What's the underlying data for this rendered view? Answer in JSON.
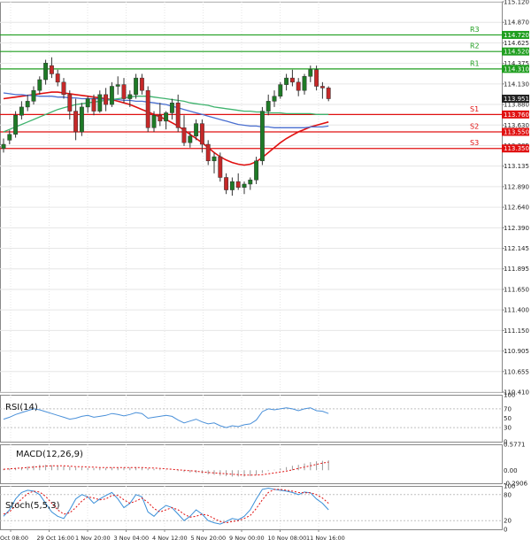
{
  "chart_data": {
    "type": "candlestick",
    "main": {
      "ylim": [
        110.41,
        115.12
      ],
      "y_ticks": [
        "115.120",
        "114.870",
        "114.625",
        "114.375",
        "114.130",
        "113.880",
        "113.630",
        "113.385",
        "113.135",
        "112.890",
        "112.640",
        "112.390",
        "112.145",
        "111.895",
        "111.650",
        "111.400",
        "111.150",
        "110.905",
        "110.655",
        "110.410"
      ],
      "levels": [
        {
          "name": "R3",
          "value": 114.72,
          "label": "114.720",
          "color": "#1f9e1f"
        },
        {
          "name": "R2",
          "value": 114.52,
          "label": "114.520",
          "color": "#1f9e1f"
        },
        {
          "name": "R1",
          "value": 114.31,
          "label": "114.310",
          "color": "#1f9e1f"
        },
        {
          "name": "S1",
          "value": 113.76,
          "label": "113.760",
          "color": "#e01010"
        },
        {
          "name": "S2",
          "value": 113.55,
          "label": "113.550",
          "color": "#e01010"
        },
        {
          "name": "S3",
          "value": 113.35,
          "label": "113.350",
          "color": "#e01010"
        }
      ],
      "current_price": "113.951",
      "candles": [
        [
          113.35,
          113.47,
          113.3,
          113.4
        ],
        [
          113.45,
          113.57,
          113.4,
          113.52
        ],
        [
          113.52,
          113.8,
          113.48,
          113.75
        ],
        [
          113.75,
          113.92,
          113.7,
          113.85
        ],
        [
          113.85,
          114.0,
          113.8,
          113.92
        ],
        [
          113.92,
          114.1,
          113.88,
          114.05
        ],
        [
          114.05,
          114.22,
          114.0,
          114.18
        ],
        [
          114.18,
          114.42,
          114.12,
          114.38
        ],
        [
          114.35,
          114.45,
          114.2,
          114.25
        ],
        [
          114.25,
          114.3,
          114.1,
          114.15
        ],
        [
          114.15,
          114.2,
          113.95,
          114.0
        ],
        [
          114.0,
          114.05,
          113.7,
          113.8
        ],
        [
          113.8,
          113.95,
          113.45,
          113.55
        ],
        [
          113.55,
          113.9,
          113.5,
          113.85
        ],
        [
          113.85,
          113.98,
          113.78,
          113.95
        ],
        [
          113.95,
          114.0,
          113.75,
          113.8
        ],
        [
          113.8,
          114.05,
          113.78,
          114.0
        ],
        [
          114.0,
          114.08,
          113.8,
          113.88
        ],
        [
          113.88,
          114.15,
          113.85,
          114.1
        ],
        [
          114.1,
          114.22,
          114.0,
          114.12
        ],
        [
          114.12,
          114.2,
          113.9,
          113.95
        ],
        [
          113.95,
          114.05,
          113.85,
          114.0
        ],
        [
          114.0,
          114.25,
          113.95,
          114.2
        ],
        [
          114.2,
          114.25,
          114.0,
          114.05
        ],
        [
          114.05,
          114.1,
          113.55,
          113.6
        ],
        [
          113.6,
          113.8,
          113.55,
          113.75
        ],
        [
          113.75,
          113.9,
          113.62,
          113.68
        ],
        [
          113.68,
          113.8,
          113.58,
          113.78
        ],
        [
          113.78,
          113.95,
          113.7,
          113.9
        ],
        [
          113.9,
          114.0,
          113.55,
          113.6
        ],
        [
          113.6,
          113.75,
          113.38,
          113.42
        ],
        [
          113.42,
          113.55,
          113.36,
          113.5
        ],
        [
          113.5,
          113.7,
          113.45,
          113.65
        ],
        [
          113.65,
          113.7,
          113.3,
          113.4
        ],
        [
          113.4,
          113.45,
          113.15,
          113.2
        ],
        [
          113.2,
          113.3,
          113.05,
          113.25
        ],
        [
          113.25,
          113.3,
          112.95,
          113.0
        ],
        [
          113.0,
          113.05,
          112.8,
          112.85
        ],
        [
          112.85,
          113.0,
          112.78,
          112.95
        ],
        [
          112.95,
          113.05,
          112.85,
          112.88
        ],
        [
          112.88,
          112.95,
          112.8,
          112.92
        ],
        [
          112.92,
          113.0,
          112.85,
          112.97
        ],
        [
          112.97,
          113.25,
          112.92,
          113.2
        ],
        [
          113.2,
          113.85,
          113.15,
          113.8
        ],
        [
          113.8,
          114.0,
          113.75,
          113.92
        ],
        [
          113.92,
          114.05,
          113.85,
          113.98
        ],
        [
          113.98,
          114.15,
          113.95,
          114.12
        ],
        [
          114.12,
          114.25,
          114.05,
          114.2
        ],
        [
          114.2,
          114.3,
          114.1,
          114.15
        ],
        [
          114.15,
          114.2,
          113.98,
          114.05
        ],
        [
          114.05,
          114.25,
          114.0,
          114.22
        ],
        [
          114.22,
          114.35,
          114.15,
          114.3
        ],
        [
          114.3,
          114.35,
          114.05,
          114.1
        ],
        [
          114.1,
          114.15,
          113.95,
          114.08
        ],
        [
          114.08,
          114.1,
          113.92,
          113.95
        ]
      ],
      "moving_averages": [
        {
          "color": "#e01010",
          "values": [
            113.95,
            113.96,
            113.97,
            113.98,
            113.99,
            114.0,
            114.01,
            114.02,
            114.03,
            114.03,
            114.02,
            114.01,
            114.0,
            113.99,
            113.98,
            113.97,
            113.96,
            113.95,
            113.94,
            113.92,
            113.9,
            113.88,
            113.85,
            113.82,
            113.79,
            113.76,
            113.73,
            113.7,
            113.66,
            113.62,
            113.57,
            113.52,
            113.47,
            113.42,
            113.36,
            113.3,
            113.25,
            113.21,
            113.18,
            113.16,
            113.15,
            113.16,
            113.19,
            113.24,
            113.3,
            113.36,
            113.42,
            113.47,
            113.51,
            113.55,
            113.58,
            113.61,
            113.63,
            113.65,
            113.67
          ]
        },
        {
          "color": "#4a6fd0",
          "values": [
            114.02,
            114.01,
            114.0,
            114.0,
            113.99,
            113.99,
            113.98,
            113.98,
            113.98,
            113.97,
            113.97,
            113.96,
            113.96,
            113.95,
            113.95,
            113.95,
            113.95,
            113.94,
            113.94,
            113.94,
            113.93,
            113.93,
            113.92,
            113.92,
            113.91,
            113.9,
            113.89,
            113.88,
            113.86,
            113.84,
            113.82,
            113.8,
            113.78,
            113.76,
            113.74,
            113.72,
            113.7,
            113.68,
            113.66,
            113.64,
            113.63,
            113.62,
            113.62,
            113.61,
            113.61,
            113.6,
            113.6,
            113.6,
            113.6,
            113.6,
            113.6,
            113.61,
            113.61,
            113.61,
            113.62
          ]
        },
        {
          "color": "#3fb36e",
          "values": [
            113.55,
            113.58,
            113.61,
            113.64,
            113.67,
            113.7,
            113.73,
            113.76,
            113.79,
            113.82,
            113.84,
            113.86,
            113.88,
            113.89,
            113.9,
            113.91,
            113.92,
            113.93,
            113.94,
            113.95,
            113.96,
            113.97,
            113.98,
            113.98,
            113.98,
            113.97,
            113.96,
            113.95,
            113.94,
            113.93,
            113.92,
            113.9,
            113.89,
            113.88,
            113.87,
            113.85,
            113.84,
            113.83,
            113.82,
            113.81,
            113.8,
            113.8,
            113.79,
            113.79,
            113.78,
            113.78,
            113.78,
            113.77,
            113.77,
            113.77,
            113.77,
            113.77,
            113.76,
            113.76,
            113.76
          ]
        }
      ]
    },
    "rsi": {
      "label": "RSI(14)",
      "ylim": [
        0,
        100
      ],
      "y_ticks": [
        "100",
        "70",
        "50",
        "30",
        "0"
      ],
      "values": [
        48,
        52,
        58,
        62,
        66,
        70,
        68,
        64,
        60,
        56,
        52,
        48,
        50,
        54,
        56,
        52,
        54,
        56,
        60,
        58,
        55,
        58,
        62,
        60,
        50,
        52,
        54,
        56,
        54,
        46,
        40,
        44,
        48,
        42,
        38,
        40,
        34,
        30,
        34,
        32,
        36,
        38,
        46,
        64,
        70,
        68,
        70,
        72,
        70,
        66,
        70,
        72,
        66,
        65,
        60
      ]
    },
    "macd": {
      "label": "MACD(12,26,9)",
      "ylim": [
        -0.2906,
        0.5771
      ],
      "y_ticks": [
        "0.5771",
        "0.00",
        "-0.2906"
      ],
      "histogram": [
        0.03,
        0.04,
        0.05,
        0.06,
        0.08,
        0.1,
        0.12,
        0.12,
        0.11,
        0.1,
        0.09,
        0.08,
        0.06,
        0.06,
        0.05,
        0.05,
        0.05,
        0.05,
        0.06,
        0.06,
        0.06,
        0.06,
        0.07,
        0.06,
        0.04,
        0.03,
        0.02,
        0.01,
        0.0,
        -0.02,
        -0.04,
        -0.05,
        -0.06,
        -0.07,
        -0.09,
        -0.1,
        -0.12,
        -0.13,
        -0.14,
        -0.14,
        -0.14,
        -0.13,
        -0.11,
        -0.06,
        -0.02,
        0.01,
        0.04,
        0.07,
        0.1,
        0.12,
        0.15,
        0.18,
        0.2,
        0.21,
        0.22
      ],
      "signal": [
        0.02,
        0.03,
        0.04,
        0.05,
        0.06,
        0.07,
        0.08,
        0.09,
        0.1,
        0.1,
        0.1,
        0.09,
        0.08,
        0.08,
        0.07,
        0.07,
        0.06,
        0.06,
        0.06,
        0.06,
        0.06,
        0.06,
        0.06,
        0.06,
        0.05,
        0.05,
        0.04,
        0.03,
        0.02,
        0.01,
        0.0,
        -0.01,
        -0.02,
        -0.04,
        -0.05,
        -0.06,
        -0.07,
        -0.08,
        -0.09,
        -0.1,
        -0.11,
        -0.11,
        -0.11,
        -0.1,
        -0.08,
        -0.06,
        -0.04,
        -0.02,
        0.01,
        0.04,
        0.07,
        0.1,
        0.13,
        0.16,
        0.18
      ]
    },
    "stoch": {
      "label": "Stoch(5,5,3)",
      "ylim": [
        0,
        100
      ],
      "y_ticks": [
        "100",
        "80",
        "20",
        "0"
      ],
      "main": [
        30,
        45,
        70,
        85,
        90,
        88,
        80,
        60,
        40,
        30,
        25,
        45,
        70,
        80,
        75,
        60,
        70,
        78,
        85,
        70,
        50,
        60,
        80,
        75,
        40,
        30,
        45,
        55,
        50,
        35,
        20,
        30,
        45,
        35,
        20,
        15,
        12,
        18,
        25,
        22,
        30,
        45,
        70,
        92,
        95,
        92,
        90,
        88,
        85,
        80,
        86,
        84,
        70,
        60,
        45
      ],
      "signal": [
        35,
        40,
        55,
        70,
        82,
        88,
        86,
        76,
        60,
        45,
        35,
        38,
        50,
        65,
        75,
        72,
        68,
        70,
        78,
        78,
        68,
        60,
        65,
        72,
        62,
        48,
        40,
        45,
        50,
        45,
        35,
        28,
        30,
        35,
        32,
        25,
        18,
        15,
        18,
        20,
        25,
        32,
        48,
        68,
        85,
        92,
        92,
        90,
        88,
        85,
        84,
        84,
        80,
        72,
        60
      ]
    },
    "x_ticks": [
      "Oct 08:00",
      "29 Oct 16:00",
      "1 Nov 20:00",
      "3 Nov 04:00",
      "4 Nov 12:00",
      "5 Nov 20:00",
      "9 Nov 00:00",
      "10 Nov 08:00",
      "11 Nov 16:00"
    ],
    "colors": {
      "bull": "#1e7a26",
      "bear": "#c62828",
      "grid": "#e6e6e6",
      "frame": "#888888",
      "text": "#222222",
      "rsi": "#4a90d9",
      "osc_main": "#3a8fd8",
      "osc_signal": "#e01010",
      "price_tag": "#222222"
    }
  }
}
